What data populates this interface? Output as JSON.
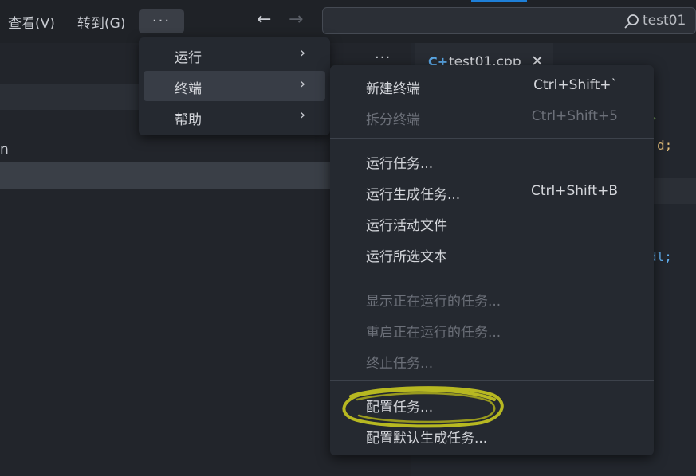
{
  "titlebar": {
    "menus": [
      "查看(V)",
      "转到(G)"
    ],
    "more_label": "···",
    "back_arrow": "←",
    "forward_arrow": "→",
    "search_text": "test01",
    "accent_color": "#1e7fd8"
  },
  "sidebar": {
    "more_label": "···",
    "row_text": "n"
  },
  "editor": {
    "tab_icon": "C+",
    "tab_label": "test01.cpp",
    "tab_close": "✕",
    "code_line1": "d;",
    "code_line2": "dl;",
    "code_chevron": ">"
  },
  "menu_level1": [
    {
      "label": "运行",
      "arrow": "›",
      "active": false
    },
    {
      "label": "终端",
      "arrow": "›",
      "active": true
    },
    {
      "label": "帮助",
      "arrow": "›",
      "active": false
    }
  ],
  "menu_level2": {
    "group1": [
      {
        "label": "新建终端",
        "shortcut": "Ctrl+Shift+`",
        "enabled": true
      },
      {
        "label": "拆分终端",
        "shortcut": "Ctrl+Shift+5",
        "enabled": false
      }
    ],
    "group2": [
      {
        "label": "运行任务...",
        "shortcut": "",
        "enabled": true
      },
      {
        "label": "运行生成任务...",
        "shortcut": "Ctrl+Shift+B",
        "enabled": true
      },
      {
        "label": "运行活动文件",
        "shortcut": "",
        "enabled": true
      },
      {
        "label": "运行所选文本",
        "shortcut": "",
        "enabled": true
      }
    ],
    "group3": [
      {
        "label": "显示正在运行的任务...",
        "shortcut": "",
        "enabled": false
      },
      {
        "label": "重启正在运行的任务...",
        "shortcut": "",
        "enabled": false
      },
      {
        "label": "终止任务...",
        "shortcut": "",
        "enabled": false
      }
    ],
    "group4": [
      {
        "label": "配置任务...",
        "shortcut": "",
        "enabled": true
      },
      {
        "label": "配置默认生成任务...",
        "shortcut": "",
        "enabled": true
      }
    ]
  },
  "annotation": {
    "highlight_color": "#c8c820"
  }
}
